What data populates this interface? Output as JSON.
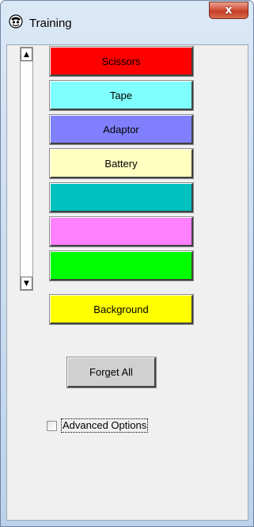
{
  "window": {
    "title": "Training",
    "close_label": "x"
  },
  "scrollbar": {
    "up_arrow": "▲",
    "down_arrow": "▼"
  },
  "classes": [
    {
      "label": "Scissors",
      "color": "#ff0000"
    },
    {
      "label": "Tape",
      "color": "#80ffff"
    },
    {
      "label": "Adaptor",
      "color": "#8080ff"
    },
    {
      "label": "Battery",
      "color": "#ffffc0"
    },
    {
      "label": "",
      "color": "#00c0c0"
    },
    {
      "label": "",
      "color": "#ff80ff"
    },
    {
      "label": "",
      "color": "#00ff00"
    },
    {
      "label": "Background",
      "color": "#ffff00"
    }
  ],
  "actions": {
    "forget_all_label": "Forget All"
  },
  "options": {
    "advanced_options_label": "Advanced Options",
    "advanced_options_checked": false
  }
}
